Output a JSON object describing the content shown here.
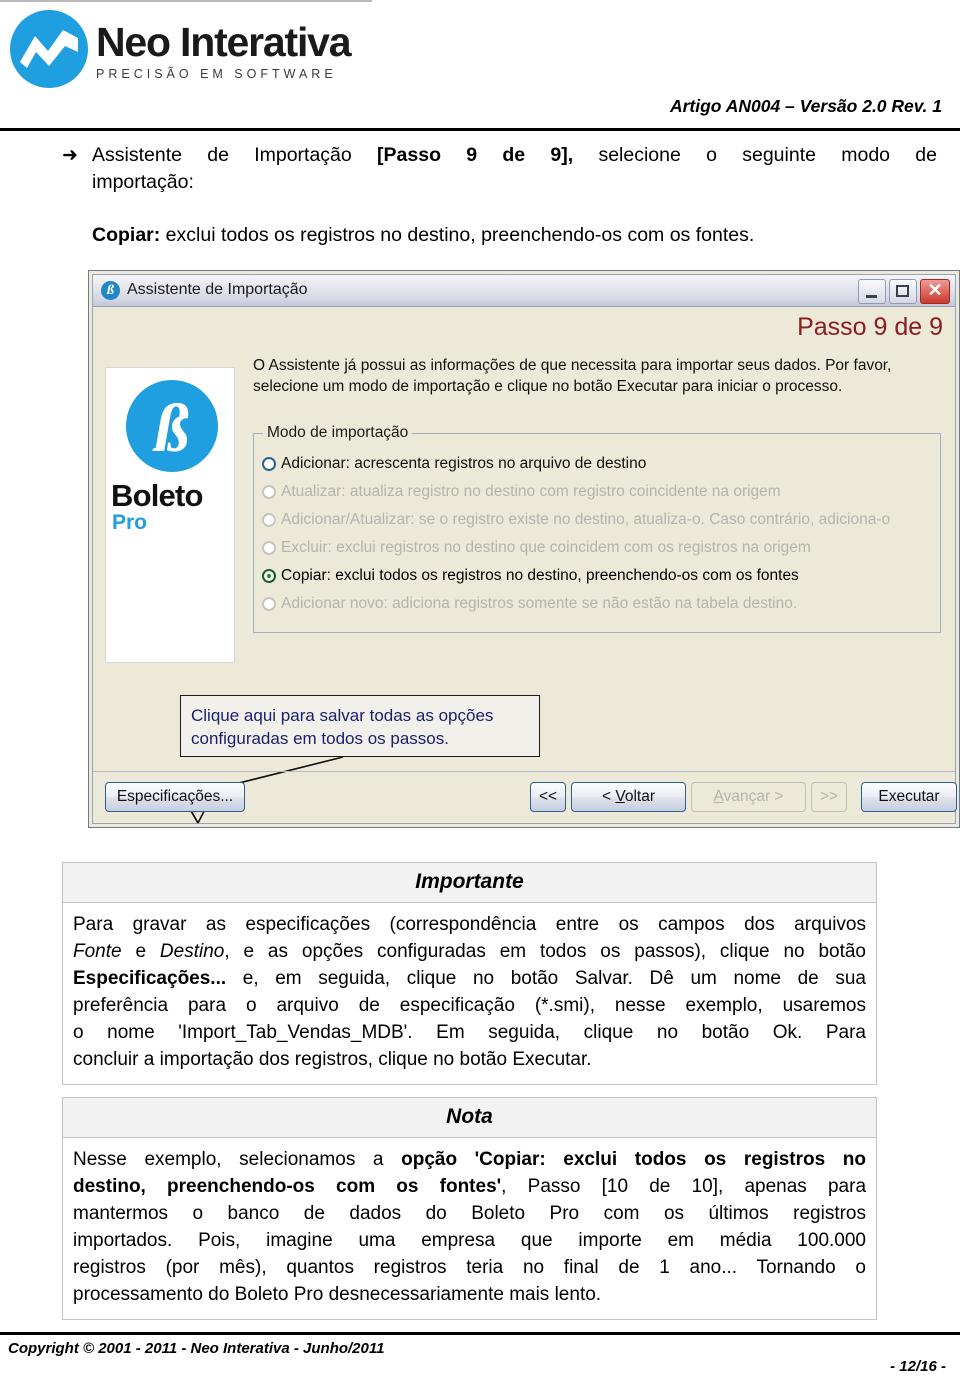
{
  "header": {
    "logo_name": "Neo Interativa",
    "logo_tagline": "PRECISÃO EM SOFTWARE",
    "logo_icon": "neo-wave-logo-icon",
    "article_ref": "Artigo AN004 – Versão 2.0 Rev. 1"
  },
  "intro": {
    "bullet_glyph": "➜",
    "line1_a": "Assistente de Importação ",
    "line1_bold": "[Passo 9 de 9],",
    "line1_b": " selecione o seguinte modo de",
    "line2": "importação:",
    "copiar_bold": "Copiar:",
    "copiar_rest": " exclui todos os registros no destino, preenchendo-os com os fontes."
  },
  "dialog": {
    "title": "Assistente de Importação",
    "title_icon": "boleto-beta-icon",
    "window_buttons": {
      "minimize": "minimize-icon",
      "maximize": "maximize-icon",
      "close": "close-icon"
    },
    "step_label": "Passo 9 de 9",
    "step_color": "#8a1c1c",
    "body_text": "O Assistente já possui as informações de que necessita para importar seus dados. Por favor, selecione um modo de importação e clique no botão Executar para iniciar o processo.",
    "product_logo": {
      "mark": "beta-circle-icon",
      "name": "Boleto",
      "sub": "Pro",
      "accent_color": "#1f9fe0"
    },
    "groupbox_title": "Modo de importação",
    "options": [
      {
        "label": "Adicionar: acrescenta registros no arquivo de destino",
        "state": "enabled",
        "selected": false
      },
      {
        "label": "Atualizar: atualiza registro no destino com registro coincidente na origem",
        "state": "disabled",
        "selected": false
      },
      {
        "label": "Adicionar/Atualizar: se o registro existe no destino, atualiza-o. Caso contrário, adiciona-o",
        "state": "disabled",
        "selected": false
      },
      {
        "label": "Excluir: exclui registros no destino que coincidem com os registros na origem",
        "state": "disabled",
        "selected": false
      },
      {
        "label": "Copiar: exclui todos os registros no destino, preenchendo-os com os fontes",
        "state": "enabled",
        "selected": true
      },
      {
        "label": "Adicionar novo: adiciona registros somente se não estão na tabela destino.",
        "state": "disabled",
        "selected": false
      }
    ],
    "callout": {
      "text": "Clique aqui para salvar todas as opções\nconfiguradas em todos os passos.",
      "color": "#1b1f6b"
    },
    "buttons": {
      "especificacoes": "Especificações...",
      "first": "<<",
      "back_pre": "< ",
      "back_accel": "V",
      "back_post": "oltar",
      "next_accel": "A",
      "next_post": "vançar >",
      "last": ">>",
      "execute": "Executar"
    }
  },
  "importante": {
    "title": "Importante",
    "l1": "Para gravar as especificações (correspondência entre os campos dos arquivos",
    "l2_a": "",
    "l2_fonte": "Fonte",
    "l2_b": " e ",
    "l2_destino": "Destino",
    "l2_c": ", e as opções configuradas em todos os passos), clique no botão",
    "l3_bold": "Especificações...",
    "l3_rest": " e, em seguida, clique no botão Salvar. Dê um nome de sua",
    "l4": "preferência para o arquivo de especificação (*.smi), nesse exemplo, usaremos",
    "l5": "o nome 'Import_Tab_Vendas_MDB'. Em seguida, clique no botão Ok. Para",
    "l6": "concluir a importação dos registros, clique no botão Executar."
  },
  "nota": {
    "title": "Nota",
    "l1_a": "Nesse exemplo, selecionamos a ",
    "l1_bold": "opção 'Copiar: exclui todos os registros no",
    "l2_bold": "destino, preenchendo-os com os fontes'",
    "l2_rest": ", Passo [10 de 10], apenas para",
    "l3": "mantermos o banco de dados do Boleto Pro com os últimos registros",
    "l4": "importados. Pois, imagine uma empresa que importe em média 100.000",
    "l5": "registros (por mês), quantos registros teria no final de 1 ano... Tornando o",
    "l6": "processamento do Boleto Pro desnecessariamente mais lento."
  },
  "footer": {
    "copyright": "Copyright © 2001 - 2011 - Neo Interativa - Junho/2011",
    "page": "- 12/16 -"
  }
}
